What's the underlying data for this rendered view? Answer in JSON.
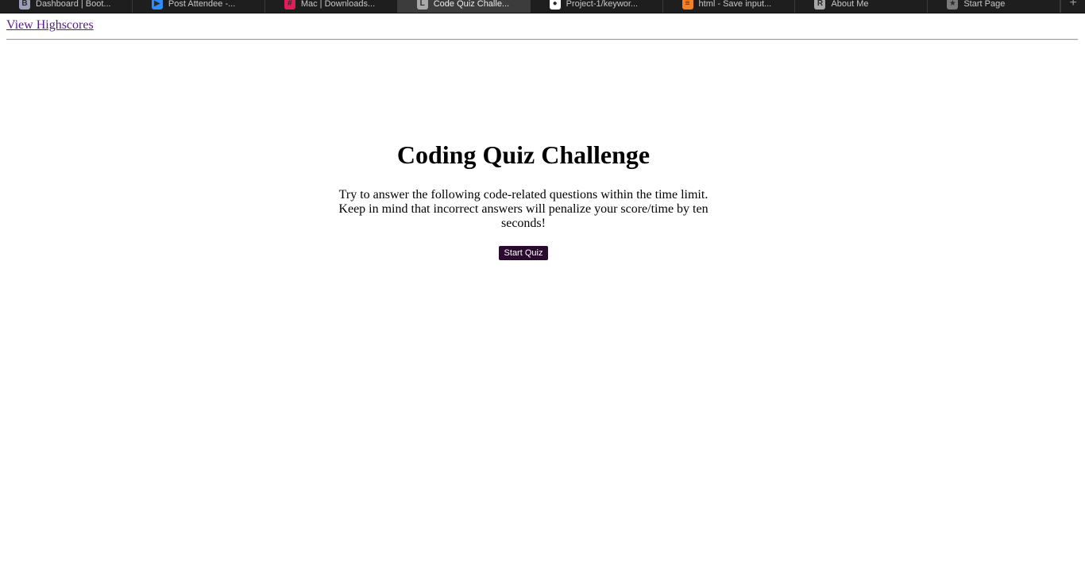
{
  "browser": {
    "tabs": [
      {
        "title": "Dashboard | Boot...",
        "favicon_letter": "B",
        "favicon_color": "#9aa0b8",
        "icon": "bootstrap-favicon",
        "active": false
      },
      {
        "title": "Post Attendee -...",
        "favicon_letter": "▶",
        "favicon_color": "#2d8cff",
        "icon": "zoom-favicon",
        "active": false
      },
      {
        "title": "Mac | Downloads...",
        "favicon_letter": "#",
        "favicon_color": "#e01e5a",
        "icon": "slack-favicon",
        "active": false
      },
      {
        "title": "Code Quiz Challe...",
        "favicon_letter": "L",
        "favicon_color": "#a8a8a8",
        "icon": "local-file-favicon",
        "active": true
      },
      {
        "title": "Project-1/keywor...",
        "favicon_letter": "●",
        "favicon_color": "#ffffff",
        "icon": "github-favicon",
        "active": false
      },
      {
        "title": "html - Save input...",
        "favicon_letter": "≡",
        "favicon_color": "#f48024",
        "icon": "stackoverflow-favicon",
        "active": false
      },
      {
        "title": "About Me",
        "favicon_letter": "R",
        "favicon_color": "#a8a8a8",
        "icon": "letter-r-favicon",
        "active": false
      },
      {
        "title": "Start Page",
        "favicon_letter": "★",
        "favicon_color": "#7a7a7a",
        "icon": "star-favicon",
        "active": false
      }
    ],
    "new_tab_symbol": "+"
  },
  "header": {
    "highscores_link": "View Highscores"
  },
  "quiz": {
    "title": "Coding Quiz Challenge",
    "intro": "Try to answer the following code-related questions within the time limit. Keep in mind that incorrect answers will penalize your score/time by ten seconds!",
    "start_button": "Start Quiz"
  },
  "colors": {
    "link_visited": "#551a8b",
    "button_bg": "#2a0a2e",
    "tabstrip_bg": "#1e1e1e"
  }
}
